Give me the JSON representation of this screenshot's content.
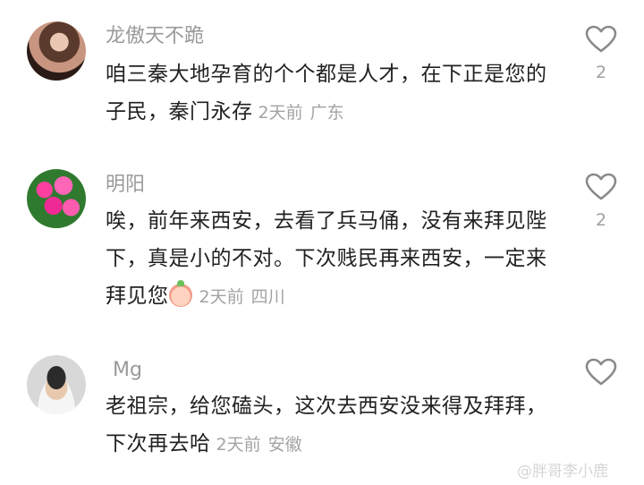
{
  "comments": [
    {
      "username": "龙傲天不跪",
      "text": "咱三秦大地孕育的个个都是人才，在下正是您的子民，秦门永存",
      "time": "2天前",
      "location": "广东",
      "likes": "2",
      "avatar": "avatar-woman-photo"
    },
    {
      "username": "明阳",
      "text": "唉，前年来西安，去看了兵马俑，没有来拜见陛下，真是小的不对。下次贱民再来西安，一定来拜见您",
      "time": "2天前",
      "location": "四川",
      "likes": "2",
      "avatar": "avatar-pink-flowers",
      "emoji": "peach-emoji"
    },
    {
      "username": "Mg",
      "text": "老祖宗，给您磕头，这次去西安没来得及拜拜，下次再去哈",
      "time": "2天前",
      "location": "安徽",
      "likes": "",
      "avatar": "avatar-man-selfie"
    }
  ],
  "watermark": "@胖哥李小鹿",
  "colors": {
    "username": "#9a9a9a",
    "text": "#222222",
    "meta": "#a3a3a3",
    "icon": "#8a8a8a"
  }
}
